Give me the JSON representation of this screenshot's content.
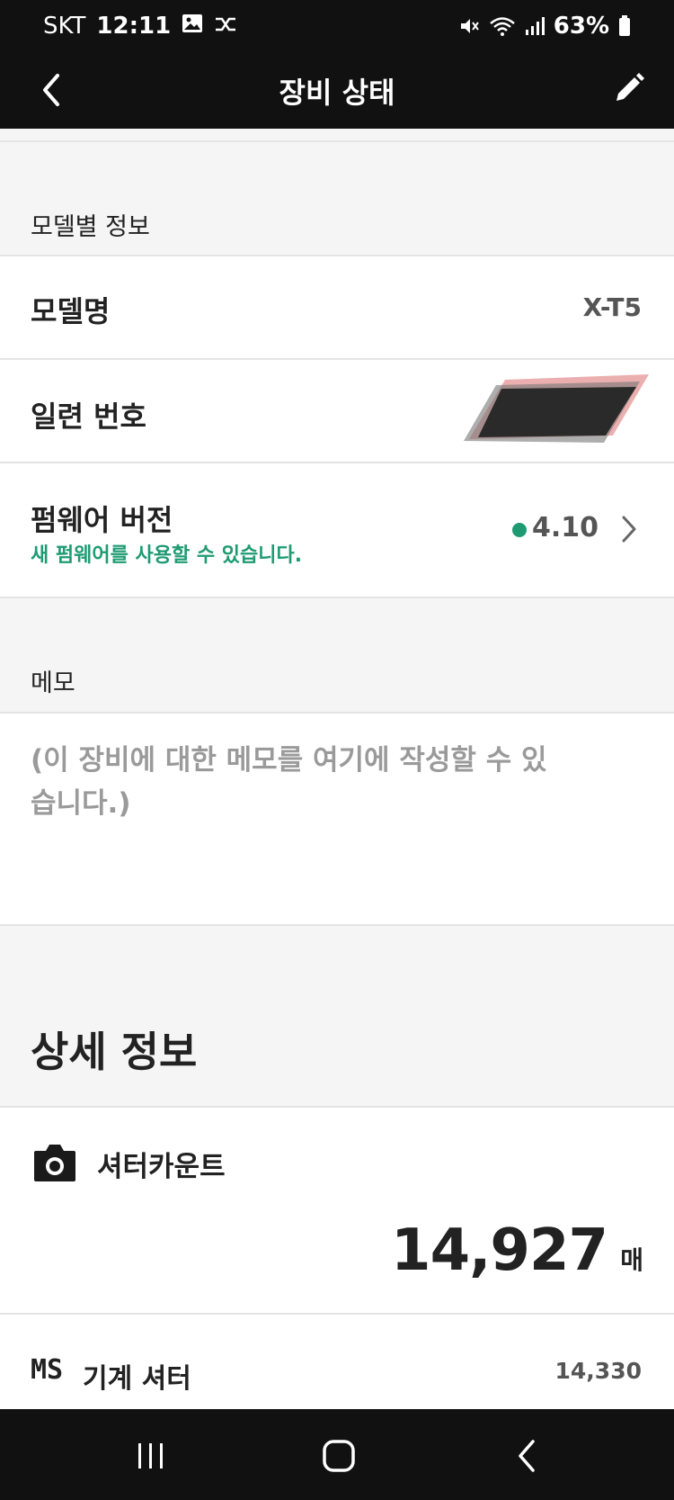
{
  "status_bar": {
    "carrier": "SKT",
    "time": "12:11",
    "battery": "63%",
    "icons": [
      "image-icon",
      "shuffle-icon",
      "mute-icon",
      "wifi-icon",
      "signal-icon",
      "battery-icon"
    ]
  },
  "app_bar": {
    "title": "장비 상태",
    "back_icon": "back-arrow-icon",
    "edit_icon": "pencil-icon"
  },
  "model_info": {
    "header": "모델별 정보",
    "model_name_label": "모델명",
    "model_name_value": "X-T5",
    "serial_label": "일련 번호",
    "firmware_label": "펌웨어 버전",
    "firmware_notice": "새 펌웨어를 사용할 수 있습니다.",
    "firmware_value": "4.10"
  },
  "memo": {
    "header": "메모",
    "placeholder": "(이 장비에 대한 메모를 여기에 작성할 수 있습니다.)"
  },
  "details": {
    "title": "상세 정보",
    "shutter_label": "셔터카운트",
    "shutter_count": "14,927",
    "shutter_unit": "매",
    "ms_badge": "MS",
    "mechanical_label": "기계 셔터",
    "mechanical_value": "14,330"
  },
  "colors": {
    "accent_green": "#1e9b72",
    "bar_black": "#111111"
  }
}
